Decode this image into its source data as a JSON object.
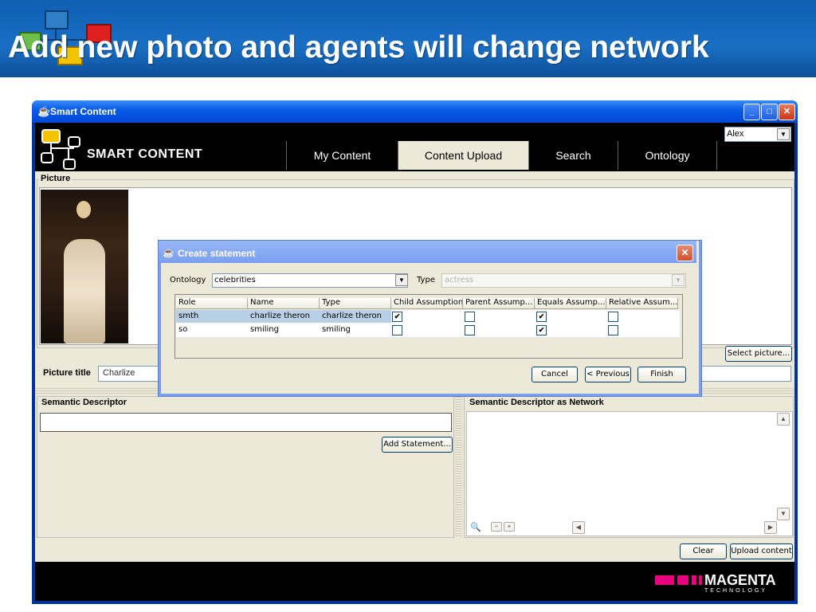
{
  "slide": {
    "title": "Add new photo and agents will change network"
  },
  "window": {
    "title": "Smart Content",
    "minimize": "_",
    "maximize": "□",
    "close": "✕"
  },
  "app": {
    "brand": "SMART CONTENT",
    "tabs": [
      {
        "label": "My Content",
        "active": false
      },
      {
        "label": "Content Upload",
        "active": true
      },
      {
        "label": "Search",
        "active": false
      },
      {
        "label": "Ontology",
        "active": false
      }
    ],
    "user": "Alex"
  },
  "picture_panel": {
    "label": "Picture",
    "select_button": "Select picture...",
    "title_label": "Picture title",
    "title_value": "Charlize"
  },
  "semantic_panel": {
    "label": "Semantic Descriptor",
    "add_button": "Add Statement..."
  },
  "network_panel": {
    "label": "Semantic Descriptor as Network"
  },
  "actions": {
    "clear": "Clear",
    "upload": "Upload content"
  },
  "footer": {
    "brand": "MAGENTA",
    "sub": "TECHNOLOGY"
  },
  "dialog": {
    "title": "Create statement",
    "ontology_label": "Ontology",
    "ontology_value": "celebrities",
    "type_label": "Type",
    "type_value": "actress",
    "columns": [
      "Role",
      "Name",
      "Type",
      "Child Assumption",
      "Parent Assump...",
      "Equals Assump...",
      "Relative Assum..."
    ],
    "rows": [
      {
        "role": "smth",
        "name": "charlize theron",
        "type": "charlize theron",
        "child": true,
        "parent": false,
        "equals": true,
        "relative": false,
        "selected": true
      },
      {
        "role": "so",
        "name": "smiling",
        "type": "smiling",
        "child": false,
        "parent": false,
        "equals": true,
        "relative": false,
        "selected": false
      }
    ],
    "buttons": {
      "cancel": "Cancel",
      "previous": "< Previous",
      "finish": "Finish"
    }
  }
}
